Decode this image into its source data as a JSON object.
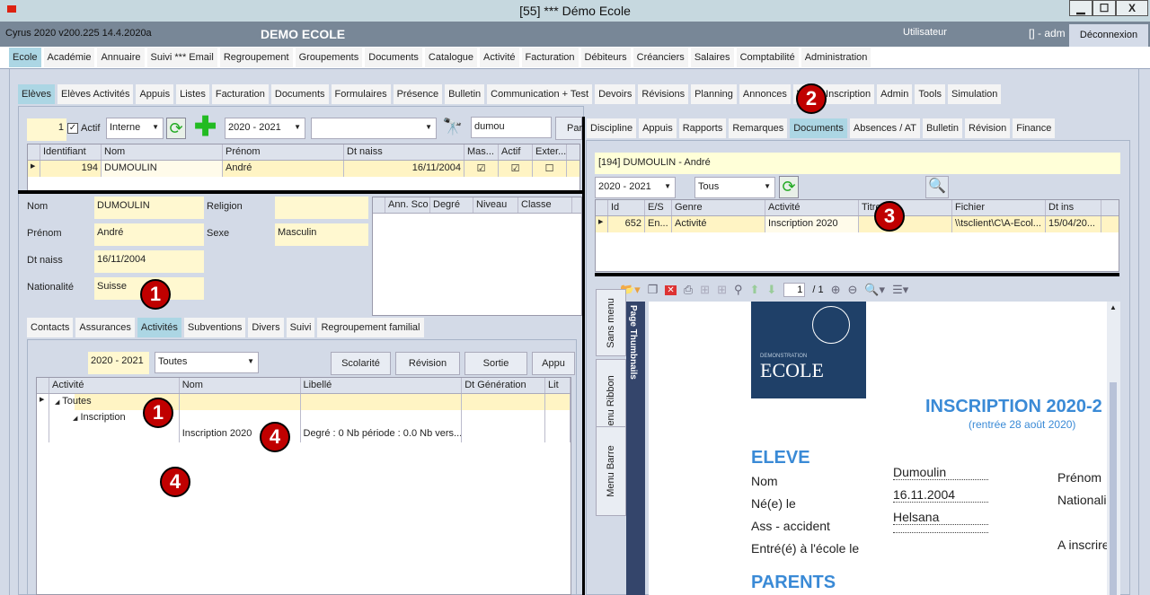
{
  "window": {
    "title": "[55] *** Démo Ecole",
    "minimize": "▁",
    "maximize": "☐",
    "close": "X"
  },
  "header": {
    "version": "Cyrus 2020 v200.225 14.4.2020a",
    "school": "DEMO ECOLE",
    "user_label": "Utilisateur",
    "user": "[] - adm",
    "logout": "Déconnexion"
  },
  "main_menu": {
    "items": [
      "Ecole",
      "Académie",
      "Annuaire",
      "Suivi *** Email",
      "Regroupement",
      "Groupements",
      "Documents",
      "Catalogue",
      "Activité",
      "Facturation",
      "Débiteurs",
      "Créanciers",
      "Salaires",
      "Comptabilité",
      "Administration"
    ],
    "selected": 0
  },
  "sub_menu": {
    "items": [
      "Elèves",
      "Elèves Activités",
      "Appuis",
      "Listes",
      "Facturation",
      "Documents",
      "Formulaires",
      "Présence",
      "Bulletin",
      "Communication + Test",
      "Devoirs",
      "Révisions",
      "Planning",
      "Annonces",
      "Web - Inscription",
      "Admin",
      "Tools",
      "Simulation"
    ],
    "selected": 0
  },
  "search": {
    "count": "1",
    "actif_label": "Actif",
    "actif_checked": true,
    "type": "Interne",
    "year": "2020 - 2021",
    "filter": "",
    "query": "dumou",
    "par": "Par"
  },
  "students_grid": {
    "columns": [
      "Identifiant",
      "Nom",
      "Prénom",
      "Dt naiss",
      "Mas...",
      "Actif",
      "Exter..."
    ],
    "rows": [
      {
        "id": "194",
        "nom": "DUMOULIN",
        "prenom": "André",
        "dt": "16/11/2004",
        "mas": true,
        "actif": true,
        "ext": false
      }
    ]
  },
  "student": {
    "nom_label": "Nom",
    "nom": "DUMOULIN",
    "prenom_label": "Prénom",
    "prenom": "André",
    "dt_label": "Dt naiss",
    "dt": "16/11/2004",
    "nat_label": "Nationalité",
    "nat": "Suisse",
    "religion_label": "Religion",
    "religion": "",
    "sexe_label": "Sexe",
    "sexe": "Masculin"
  },
  "classes_grid": {
    "columns": [
      "Ann. Sco",
      "Degré",
      "Niveau",
      "Classe"
    ]
  },
  "detail_tabs": {
    "items": [
      "Contacts",
      "Assurances",
      "Activités",
      "Subventions",
      "Divers",
      "Suivi",
      "Regroupement familial"
    ],
    "selected": 2
  },
  "activities": {
    "year": "2020 - 2021",
    "filter": "Toutes",
    "buttons": [
      "Scolarité",
      "Révision",
      "Sortie",
      "Appu"
    ],
    "columns": [
      "Activité",
      "Nom",
      "Libellé",
      "Dt Génération",
      "Lit"
    ],
    "tree": [
      {
        "label": "Toutes",
        "level": 0
      },
      {
        "label": "Inscription",
        "level": 1
      },
      {
        "label": "",
        "level": 2,
        "nom": "Inscription 2020",
        "libelle": "Degré : 0 Nb période : 0.0 Nb vers..."
      }
    ]
  },
  "right_tabs": {
    "items": [
      "Discipline",
      "Appuis",
      "Rapports",
      "Remarques",
      "Documents",
      "Absences / AT",
      "Bulletin",
      "Révision",
      "Finance"
    ],
    "selected": 4
  },
  "documents": {
    "student": "[194] DUMOULIN - André",
    "year": "2020 - 2021",
    "filter": "Tous",
    "columns": [
      "Id",
      "E/S",
      "Genre",
      "Activité",
      "Titre",
      "Fichier",
      "Dt ins"
    ],
    "rows": [
      {
        "id": "652",
        "es": "En...",
        "genre": "Activité",
        "activite": "Inscription 2020",
        "titre": "",
        "fichier": "\\\\tsclient\\C\\A-Ecol...",
        "dt": "15/04/20..."
      }
    ]
  },
  "viewer": {
    "page": "1",
    "total": "/ 1",
    "side_tabs": [
      "Sans menu",
      "Menu Ribbon",
      "Menu Barre"
    ],
    "thumbnails": "Page Thumbnails"
  },
  "pdf": {
    "logo_small": "DEMONSTRATION",
    "logo_big": "ECOLE",
    "title": "INSCRIPTION 2020-2",
    "subtitle": "(rentrée 28 août 2020)",
    "section1": "ELEVE",
    "rows": [
      {
        "label": "Nom",
        "value": "Dumoulin",
        "right": "Prénom"
      },
      {
        "label": "Né(e) le",
        "value": "16.11.2004",
        "right": "Nationali"
      },
      {
        "label": "Ass - accident",
        "value": "Helsana",
        "right": ""
      },
      {
        "label": "Entré(é) à l'école le",
        "value": "",
        "right": "A inscrire"
      }
    ],
    "section2": "PARENTS"
  },
  "annotations": [
    "1",
    "2",
    "3",
    "1",
    "4",
    "4"
  ],
  "colors": {
    "accent_tab": "#acd6e4",
    "field": "#fff8d0",
    "header": "#788797",
    "annotation": "#c00000",
    "pdf_blue": "#3a8ad6"
  }
}
